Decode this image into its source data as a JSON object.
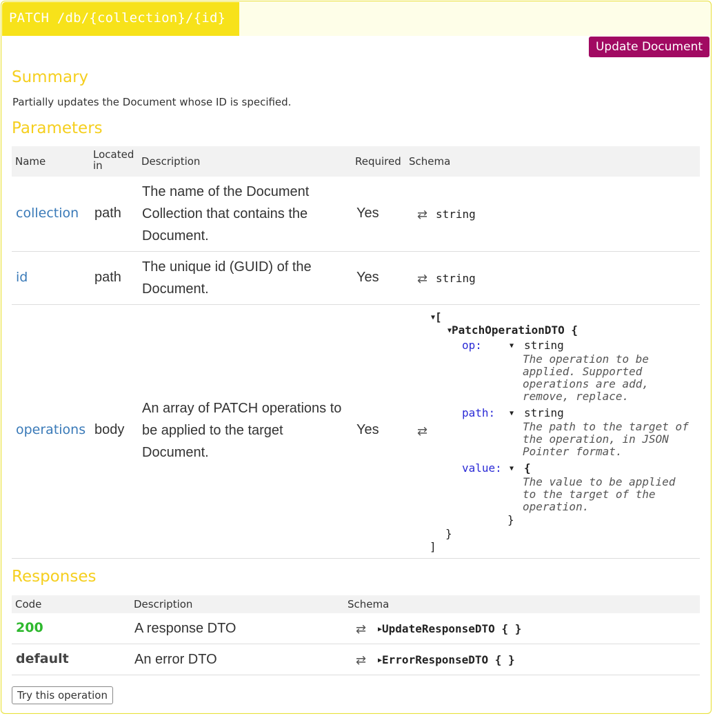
{
  "endpoint": {
    "method_path": "PATCH /db/{collection}/{id}",
    "action_label": "Update Document"
  },
  "summary": {
    "title": "Summary",
    "text": "Partially updates the Document whose ID is specified."
  },
  "parameters": {
    "title": "Parameters",
    "headers": {
      "name": "Name",
      "located_in_1": "Located",
      "located_in_2": "in",
      "description": "Description",
      "required": "Required",
      "schema": "Schema"
    },
    "rows": [
      {
        "name": "collection",
        "located": "path",
        "desc": [
          "The name of the Document",
          "Collection that contains the",
          "Document."
        ],
        "required": "Yes",
        "type": "string"
      },
      {
        "name": "id",
        "located": "path",
        "desc": [
          "The unique id (GUID) of the",
          "Document."
        ],
        "required": "Yes",
        "type": "string"
      },
      {
        "name": "operations",
        "located": "body",
        "desc": [
          "An array of PATCH operations to",
          "be applied to the target",
          "Document."
        ],
        "required": "Yes"
      }
    ],
    "schema_tree": {
      "open_bracket": "[",
      "model": "PatchOperationDTO {",
      "op_key": "op:",
      "op_type": "string",
      "op_desc": [
        "The operation to be",
        "applied. Supported",
        "operations are add,",
        "remove, replace."
      ],
      "path_key": "path:",
      "path_type": "string",
      "path_desc": [
        "The path to the target of",
        "the operation, in JSON",
        "Pointer format."
      ],
      "value_key": "value:",
      "value_type": "{",
      "value_desc": [
        "The value to be applied",
        "to the target of the",
        "operation."
      ],
      "value_close": "}",
      "model_close": "}",
      "close_bracket": "]"
    }
  },
  "responses": {
    "title": "Responses",
    "headers": {
      "code": "Code",
      "description": "Description",
      "schema": "Schema"
    },
    "rows": [
      {
        "code": "200",
        "desc": "A response DTO",
        "schema": "UpdateResponseDTO { }"
      },
      {
        "code": "default",
        "desc": "An error DTO",
        "schema": "ErrorResponseDTO { }"
      }
    ]
  },
  "try_label": "Try this operation",
  "icons": {
    "swap": "⇄",
    "expanded": "▼",
    "collapsed": "▶"
  },
  "colors": {
    "accent_yellow": "#f7e21a",
    "section_title": "#f5cf1f",
    "button_bg": "#a10a62",
    "link": "#3a7ab8",
    "code_ok": "#2eb82e"
  }
}
